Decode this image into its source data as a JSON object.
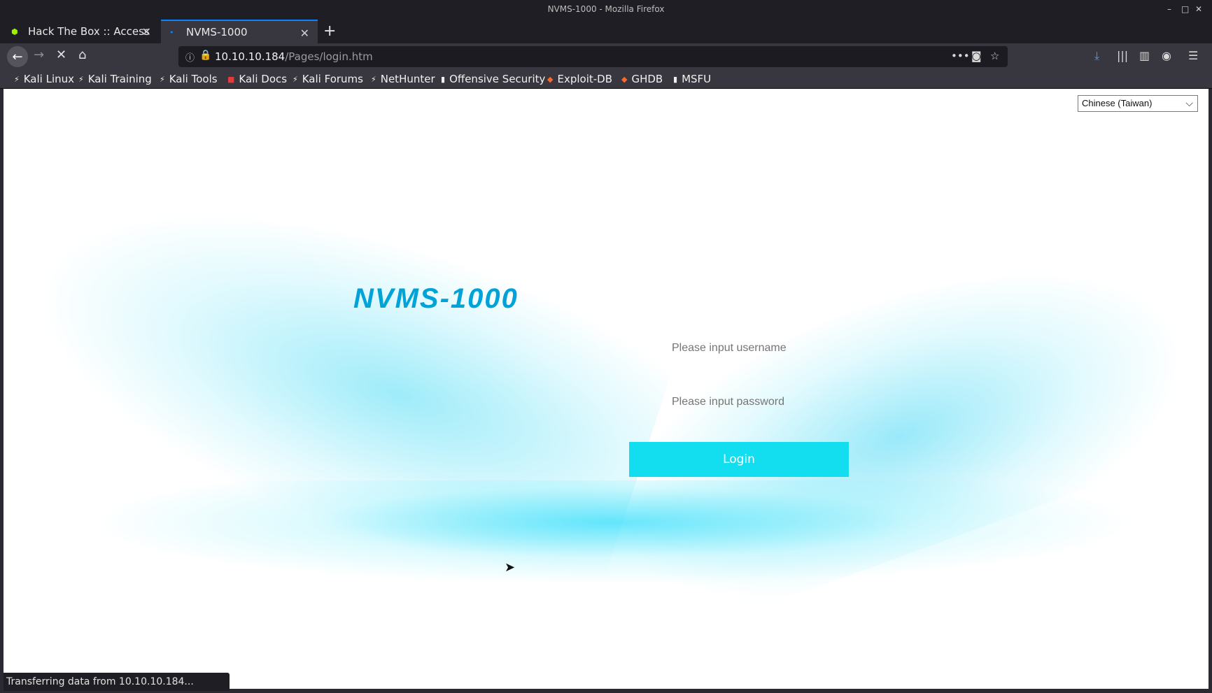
{
  "window": {
    "title": "NVMS-1000 - Mozilla Firefox"
  },
  "tabs": [
    {
      "label": "Hack The Box :: Access",
      "active": false
    },
    {
      "label": "NVMS-1000",
      "active": true
    }
  ],
  "urlbar": {
    "host": "10.10.10.184",
    "path": "/Pages/login.htm"
  },
  "bookmarks": [
    {
      "label": "Kali Linux"
    },
    {
      "label": "Kali Training"
    },
    {
      "label": "Kali Tools"
    },
    {
      "label": "Kali Docs"
    },
    {
      "label": "Kali Forums"
    },
    {
      "label": "NetHunter"
    },
    {
      "label": "Offensive Security"
    },
    {
      "label": "Exploit-DB"
    },
    {
      "label": "GHDB"
    },
    {
      "label": "MSFU"
    }
  ],
  "page": {
    "language": "Chinese (Taiwan)",
    "logo_text": "NVMS-1000",
    "username_placeholder": "Please input username",
    "password_placeholder": "Please input password",
    "login_label": "Login"
  },
  "status": {
    "text": "Transferring data from 10.10.10.184..."
  },
  "colors": {
    "accent": "#12def0",
    "logo": "#00a3d7",
    "tab_highlight": "#0a84ff"
  }
}
